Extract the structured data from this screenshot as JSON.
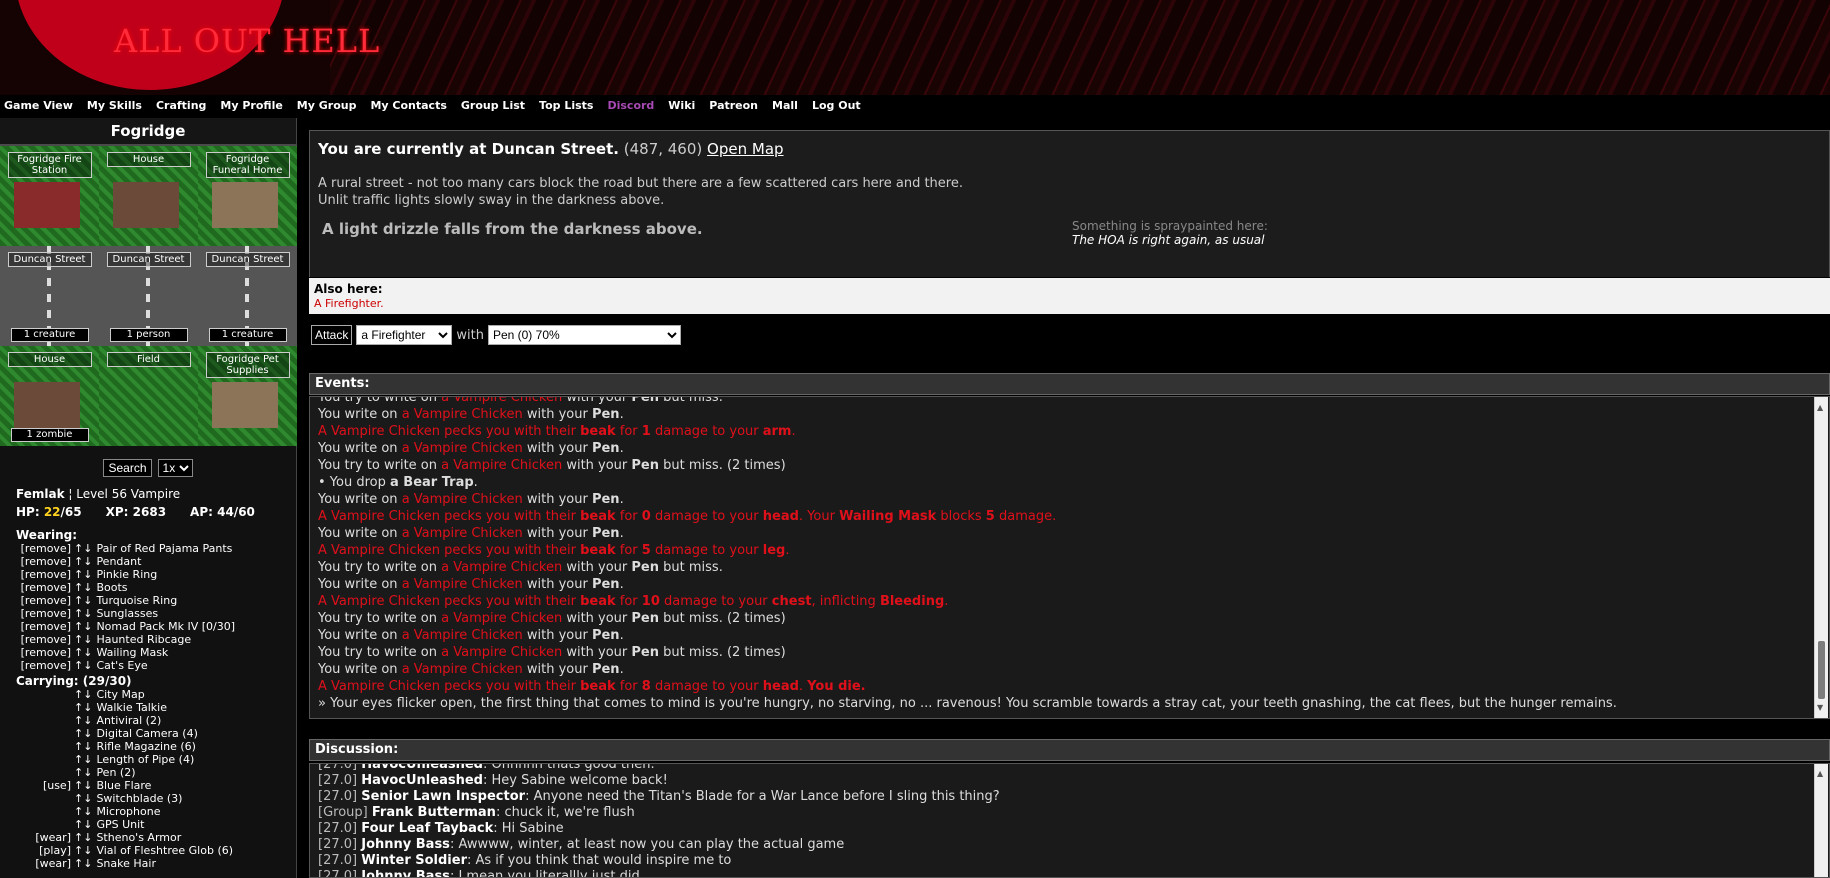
{
  "brand": {
    "logo": "ALL OUT HELL"
  },
  "nav": [
    "Game View",
    "My Skills",
    "Crafting",
    "My Profile",
    "My Group",
    "My Contacts",
    "Group List",
    "Top Lists",
    "Discord",
    "Wiki",
    "Patreon",
    "Mall",
    "Log Out"
  ],
  "colors": {
    "discord_link": "#a64ab3",
    "hostile": "#e0101a",
    "hp_current": "#ffd21f"
  },
  "left": {
    "location_title": "Fogridge",
    "map_tiles": [
      {
        "label": "Fogridge Fire Station",
        "count": "",
        "kind": "building-red"
      },
      {
        "label": "House",
        "count": "",
        "kind": "house"
      },
      {
        "label": "Fogridge Funeral Home",
        "count": "",
        "kind": "building-tan"
      },
      {
        "label": "Duncan Street",
        "count": "1 creature",
        "kind": "road"
      },
      {
        "label": "Duncan Street",
        "count": "1 person",
        "kind": "road"
      },
      {
        "label": "Duncan Street",
        "count": "1 creature",
        "kind": "road"
      },
      {
        "label": "House",
        "count": "1 zombie",
        "kind": "house"
      },
      {
        "label": "Field",
        "count": "",
        "kind": "field"
      },
      {
        "label": "Fogridge Pet Supplies",
        "count": "",
        "kind": "building-tan"
      }
    ],
    "search_button": "Search",
    "search_multiplier": "1x",
    "character": {
      "name": "Femlak",
      "level": "Level 56 Vampire",
      "hp_label": "HP:",
      "hp_current": "22",
      "hp_max": "/65",
      "xp": "XP: 2683",
      "ap": "AP: 44/60"
    },
    "wearing_label": "Wearing:",
    "wearing": [
      {
        "action": "[remove]",
        "name": "Pair of Red Pajama Pants"
      },
      {
        "action": "[remove]",
        "name": "Pendant"
      },
      {
        "action": "[remove]",
        "name": "Pinkie Ring"
      },
      {
        "action": "[remove]",
        "name": "Boots"
      },
      {
        "action": "[remove]",
        "name": "Turquoise Ring"
      },
      {
        "action": "[remove]",
        "name": "Sunglasses"
      },
      {
        "action": "[remove]",
        "name": "Nomad Pack Mk IV [0/30]"
      },
      {
        "action": "[remove]",
        "name": "Haunted Ribcage"
      },
      {
        "action": "[remove]",
        "name": "Wailing Mask"
      },
      {
        "action": "[remove]",
        "name": "Cat's Eye"
      }
    ],
    "carrying_label": "Carrying: (29/30)",
    "carrying": [
      {
        "action": "",
        "name": "City Map"
      },
      {
        "action": "",
        "name": "Walkie Talkie"
      },
      {
        "action": "",
        "name": "Antiviral (2)"
      },
      {
        "action": "",
        "name": "Digital Camera (4)"
      },
      {
        "action": "",
        "name": "Rifle Magazine (6)"
      },
      {
        "action": "",
        "name": "Length of Pipe (4)"
      },
      {
        "action": "",
        "name": "Pen (2)"
      },
      {
        "action": "[use]",
        "name": "Blue Flare"
      },
      {
        "action": "",
        "name": "Switchblade (3)"
      },
      {
        "action": "",
        "name": "Microphone"
      },
      {
        "action": "",
        "name": "GPS Unit"
      },
      {
        "action": "[wear]",
        "name": "Stheno's Armor"
      },
      {
        "action": "[play]",
        "name": "Vial of Fleshtree Glob (6)"
      },
      {
        "action": "[wear]",
        "name": "Snake Hair"
      }
    ]
  },
  "location": {
    "current_prefix": "You are currently at Duncan Street.",
    "coords": "(487, 460)",
    "open_map": "Open Map",
    "description_1": "A rural street - not too many cars block the road but there are a few scattered cars here and there.",
    "description_2": "Unlit traffic lights slowly sway in the darkness above.",
    "weather": "A light drizzle falls from the darkness above.",
    "spray_label": "Something is spraypainted here:",
    "spray_text": "The HOA is right again, as usual"
  },
  "also_here": {
    "label": "Also here:",
    "who": "A Firefighter",
    "suffix": "."
  },
  "attack": {
    "button": "Attack",
    "target": "a Firefighter",
    "with_label": "with",
    "weapon": "Pen (0) 70%"
  },
  "events": {
    "title": "Events:",
    "lines": [
      {
        "t": "plain",
        "a": "You try to write on ",
        "b": "a Vampire Chicken",
        "c": " with your ",
        "d": "Pen",
        "e": " but miss."
      },
      {
        "t": "write",
        "a": "You write on ",
        "b": "a Vampire Chicken",
        "c": " with your ",
        "d": "Pen",
        "e": "."
      },
      {
        "t": "peck",
        "a": "A Vampire Chicken pecks you with their ",
        "b": "beak",
        "c": " for ",
        "d": "1",
        "e": " damage to your ",
        "f": "arm",
        "g": "."
      },
      {
        "t": "write",
        "a": "You write on ",
        "b": "a Vampire Chicken",
        "c": " with your ",
        "d": "Pen",
        "e": "."
      },
      {
        "t": "write",
        "a": "You try to write on ",
        "b": "a Vampire Chicken",
        "c": " with your ",
        "d": "Pen",
        "e": " but miss. (2 times)"
      },
      {
        "t": "drop",
        "a": "• You drop ",
        "b": "a Bear Trap",
        "c": "."
      },
      {
        "t": "write",
        "a": "You write on ",
        "b": "a Vampire Chicken",
        "c": " with your ",
        "d": "Pen",
        "e": "."
      },
      {
        "t": "peck2",
        "a": "A Vampire Chicken pecks you with their ",
        "b": "beak",
        "c": " for ",
        "d": "0",
        "e": " damage to your ",
        "f": "head",
        "g": ". Your ",
        "h": "Wailing Mask",
        "i": " blocks ",
        "j": "5",
        "k": " damage."
      },
      {
        "t": "write",
        "a": "You write on ",
        "b": "a Vampire Chicken",
        "c": " with your ",
        "d": "Pen",
        "e": "."
      },
      {
        "t": "peck",
        "a": "A Vampire Chicken pecks you with their ",
        "b": "beak",
        "c": " for ",
        "d": "5",
        "e": " damage to your ",
        "f": "leg",
        "g": "."
      },
      {
        "t": "write",
        "a": "You try to write on ",
        "b": "a Vampire Chicken",
        "c": " with your ",
        "d": "Pen",
        "e": " but miss."
      },
      {
        "t": "write",
        "a": "You write on ",
        "b": "a Vampire Chicken",
        "c": " with your ",
        "d": "Pen",
        "e": "."
      },
      {
        "t": "peck3",
        "a": "A Vampire Chicken pecks you with their ",
        "b": "beak",
        "c": " for ",
        "d": "10",
        "e": " damage to your ",
        "f": "chest",
        "g": ", inflicting ",
        "h": "Bleeding",
        "i": "."
      },
      {
        "t": "write",
        "a": "You try to write on ",
        "b": "a Vampire Chicken",
        "c": " with your ",
        "d": "Pen",
        "e": " but miss. (2 times)"
      },
      {
        "t": "write",
        "a": "You write on ",
        "b": "a Vampire Chicken",
        "c": " with your ",
        "d": "Pen",
        "e": "."
      },
      {
        "t": "write",
        "a": "You try to write on ",
        "b": "a Vampire Chicken",
        "c": " with your ",
        "d": "Pen",
        "e": " but miss. (2 times)"
      },
      {
        "t": "write",
        "a": "You write on ",
        "b": "a Vampire Chicken",
        "c": " with your ",
        "d": "Pen",
        "e": "."
      },
      {
        "t": "peck4",
        "a": "A Vampire Chicken pecks you with their ",
        "b": "beak",
        "c": " for ",
        "d": "8",
        "e": " damage to your ",
        "f": "head",
        "g": ". ",
        "h": "You die."
      },
      {
        "t": "text",
        "a": "» Your eyes flicker open, the first thing that comes to mind is you're hungry, no starving, no ... ravenous! You scramble towards a stray cat, your teeth gnashing, the cat flees, but the hunger remains."
      }
    ]
  },
  "discussion": {
    "title": "Discussion:",
    "messages": [
      {
        "ts": "[27.0]",
        "name": "HavocUnleashed",
        "text": ": Ohhhhh thats good then."
      },
      {
        "ts": "[27.0]",
        "name": "HavocUnleashed",
        "text": ": Hey Sabine welcome back!"
      },
      {
        "ts": "[27.0]",
        "name": "Senior Lawn Inspector",
        "text": ": Anyone need the Titan's Blade for a War Lance before I sling this thing?"
      },
      {
        "ts": "[Group]",
        "name": "Frank Butterman",
        "text": ": chuck it, we're flush"
      },
      {
        "ts": "[27.0]",
        "name": "Four Leaf Tayback",
        "text": ": Hi Sabine"
      },
      {
        "ts": "[27.0]",
        "name": "Johnny Bass",
        "text": ": Awwww, winter, at least now you can play the actual game"
      },
      {
        "ts": "[27.0]",
        "name": "Winter Soldier",
        "text": ": As if you think that would inspire me to"
      },
      {
        "ts": "[27.0]",
        "name": "Johnny Bass",
        "text": ": I mean you literallly just did"
      }
    ]
  }
}
